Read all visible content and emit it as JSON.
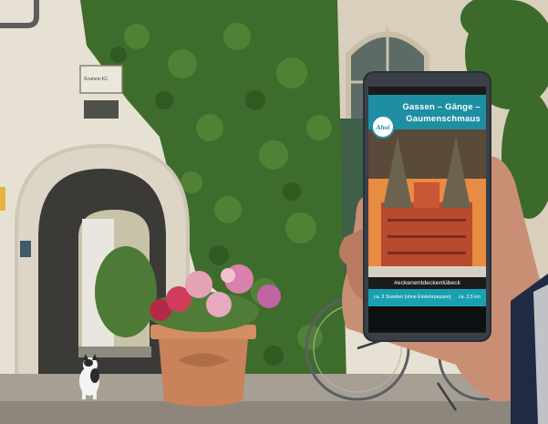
{
  "phone_screen": {
    "header_line1": "Gassen – Gänge –",
    "header_line2": "Gaumenschmaus",
    "logo_text": "Ahoi",
    "hashtag": "#eckenentdeckenlübeck",
    "duration": "ca. 3 Stunden (ohne Einkehrpausen)",
    "distance": "ca. 3,5 km"
  },
  "sign_text": "Kranen-Kl.",
  "colors": {
    "accent": "#1e8fa3",
    "ivy": "#3d6b2b",
    "wall": "#e9e4d8",
    "pot": "#c9825a"
  }
}
